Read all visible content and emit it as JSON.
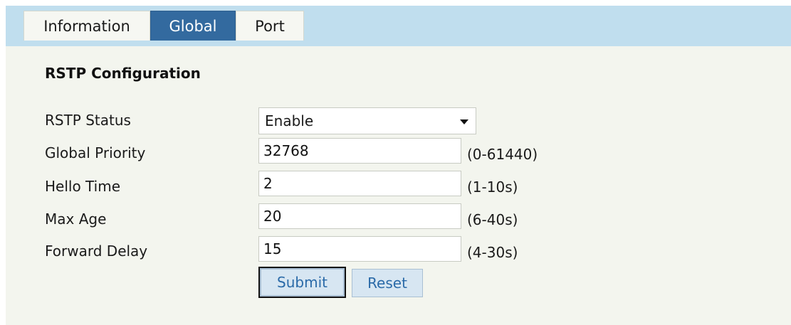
{
  "tabs": {
    "information": "Information",
    "global": "Global",
    "port": "Port",
    "active": "Global"
  },
  "section_title": "RSTP Configuration",
  "form": {
    "rstp_status": {
      "label": "RSTP Status",
      "value": "Enable"
    },
    "global_priority": {
      "label": "Global Priority",
      "value": "32768",
      "range": "(0-61440)"
    },
    "hello_time": {
      "label": "Hello Time",
      "value": "2",
      "range": "(1-10s)"
    },
    "max_age": {
      "label": "Max Age",
      "value": "20",
      "range": "(6-40s)"
    },
    "forward_delay": {
      "label": "Forward Delay",
      "value": "15",
      "range": "(4-30s)"
    }
  },
  "buttons": {
    "submit": "Submit",
    "reset": "Reset"
  },
  "colors": {
    "tabbar_bg": "#c0deee",
    "active_tab_bg": "#336a9f",
    "panel_bg": "#f3f5ee",
    "button_text": "#2a6aa8"
  }
}
